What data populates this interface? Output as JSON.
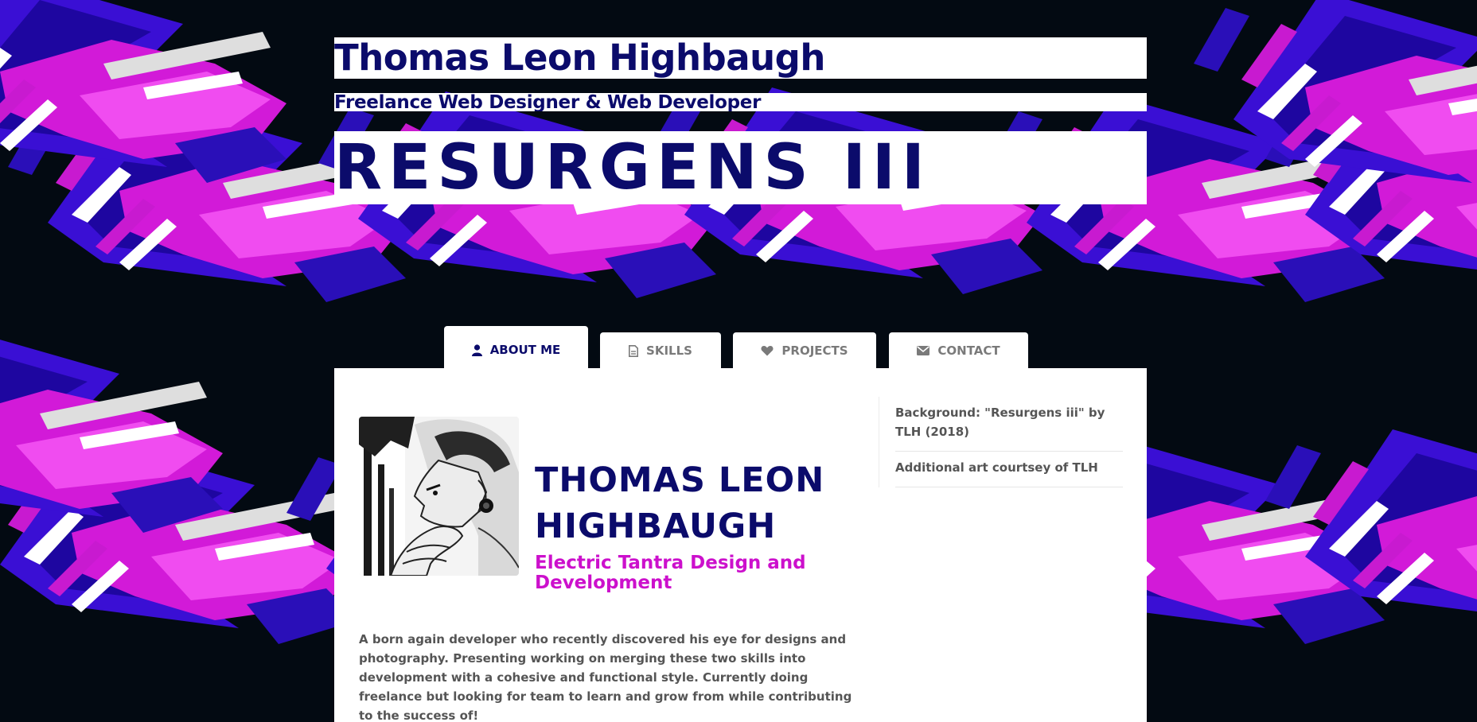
{
  "header": {
    "name": "Thomas Leon Highbaugh",
    "subtitle": "Freelance Web Designer & Web Developer",
    "artwork_title": "RESURGENS III"
  },
  "tabs": [
    {
      "label": "ABOUT ME",
      "icon": "user-icon",
      "active": true
    },
    {
      "label": "SKILLS",
      "icon": "document-icon",
      "active": false
    },
    {
      "label": "PROJECTS",
      "icon": "heart-icon",
      "active": false
    },
    {
      "label": "CONTACT",
      "icon": "envelope-icon",
      "active": false
    }
  ],
  "profile": {
    "name": "THOMAS LEON HIGHBAUGH",
    "company": "Electric Tantra Design and Development",
    "photo_icon": "portrait-photo",
    "bio": "A born again developer who recently discovered his eye for designs and photography. Presenting working on merging these two skills into development with a cohesive and functional style. Currently doing freelance but looking for team to learn and grow from while contributing to the success of!"
  },
  "sidebar": {
    "items": [
      "Background: \"Resurgens iii\" by TLH (2018)",
      "Additional art courtsey of TLH"
    ]
  },
  "colors": {
    "navy": "#0b0b6b",
    "magenta": "#cc10cc",
    "background": "#030a12",
    "gray_text": "#555555",
    "tab_inactive": "#7a7a7a"
  }
}
